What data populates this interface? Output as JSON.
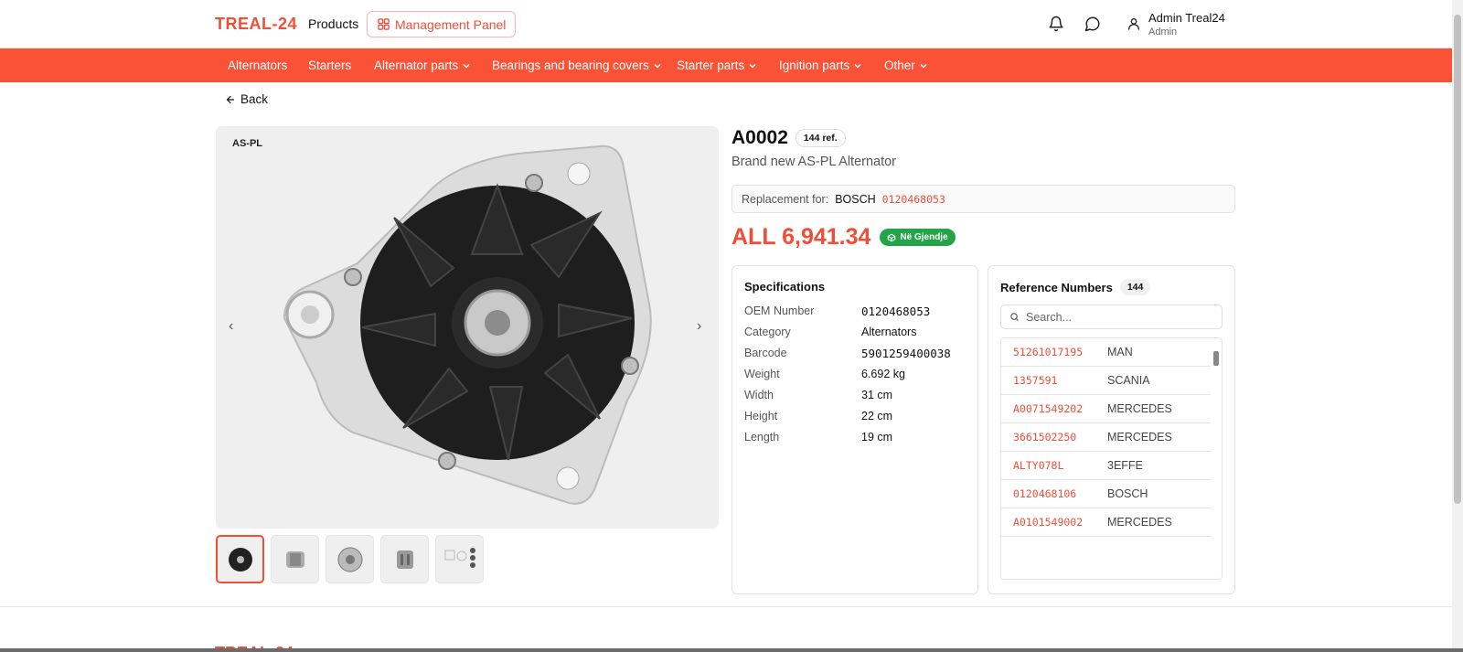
{
  "header": {
    "logo": "TREAL-24",
    "products_label": "Products",
    "management_label": "Management Panel",
    "user_name": "Admin Treal24",
    "user_role": "Admin"
  },
  "categories": [
    {
      "label": "Alternators",
      "dropdown": false
    },
    {
      "label": "Starters",
      "dropdown": false
    },
    {
      "label": "Alternator parts",
      "dropdown": true
    },
    {
      "label": "Bearings and bearing covers",
      "dropdown": true
    },
    {
      "label": "Starter parts",
      "dropdown": true
    },
    {
      "label": "Ignition parts",
      "dropdown": true
    },
    {
      "label": "Other",
      "dropdown": true
    }
  ],
  "back_label": "Back",
  "gallery": {
    "brand_tag": "AS-PL"
  },
  "product": {
    "id": "A0002",
    "ref_count_label": "144 ref.",
    "subtitle": "Brand new AS-PL Alternator",
    "replacement_label": "Replacement for:",
    "replacement_brand": "BOSCH",
    "replacement_number": "0120468053",
    "price": "ALL 6,941.34",
    "stock_label": "Në Gjendje"
  },
  "specs": {
    "title": "Specifications",
    "rows": [
      {
        "key": "OEM Number",
        "value": "0120468053"
      },
      {
        "key": "Category",
        "value": "Alternators"
      },
      {
        "key": "Barcode",
        "value": "5901259400038"
      },
      {
        "key": "Weight",
        "value": "6.692 kg"
      },
      {
        "key": "Width",
        "value": "31 cm"
      },
      {
        "key": "Height",
        "value": "22 cm"
      },
      {
        "key": "Length",
        "value": "19 cm"
      }
    ]
  },
  "refs": {
    "title": "Reference Numbers",
    "count": "144",
    "search_placeholder": "Search...",
    "items": [
      {
        "num": "51261017195",
        "brand": "MAN"
      },
      {
        "num": "1357591",
        "brand": "SCANIA"
      },
      {
        "num": "A0071549202",
        "brand": "MERCEDES"
      },
      {
        "num": "3661502250",
        "brand": "MERCEDES"
      },
      {
        "num": "ALTY078L",
        "brand": "3EFFE"
      },
      {
        "num": "0120468106",
        "brand": "BOSCH"
      },
      {
        "num": "A0101549002",
        "brand": "MERCEDES"
      }
    ]
  },
  "colors": {
    "accent": "#f04e37",
    "category_bar": "#fa5237",
    "stock_green": "#22a447"
  }
}
